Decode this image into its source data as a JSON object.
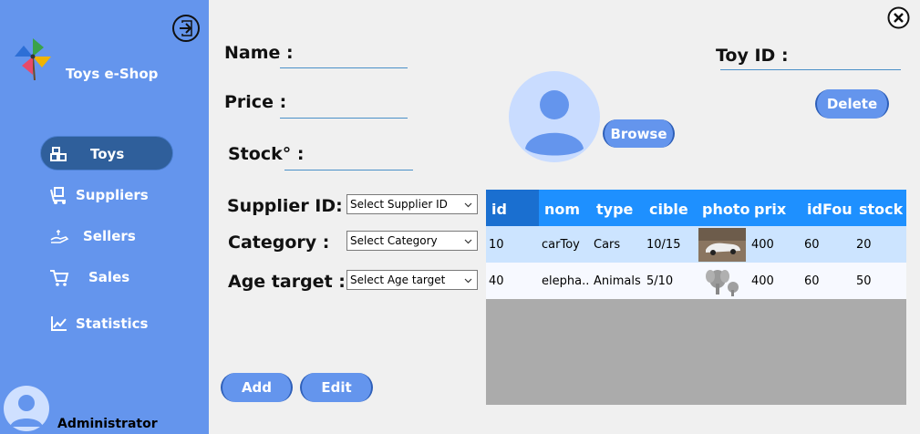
{
  "sidebar": {
    "brand": "Toys e-Shop",
    "nav": [
      {
        "label": "Toys",
        "icon": "toys-icon"
      },
      {
        "label": "Suppliers",
        "icon": "suppliers-icon"
      },
      {
        "label": "Sellers",
        "icon": "sellers-icon"
      },
      {
        "label": "Sales",
        "icon": "cart-icon"
      },
      {
        "label": "Statistics",
        "icon": "chart-icon"
      }
    ],
    "user": "Administrator"
  },
  "form": {
    "name_label": "Name :",
    "price_label": "Price :",
    "stock_label": "Stock° :",
    "toy_id_label": "Toy ID :",
    "supplier_label": "Supplier ID:",
    "category_label": "Category  :",
    "age_label": "Age target  :",
    "supplier_value": "Select Supplier ID",
    "category_value": "Select Category",
    "age_value": "Select Age target",
    "browse": "Browse",
    "delete": "Delete",
    "add": "Add",
    "edit": "Edit"
  },
  "grid": {
    "headers": [
      "id",
      "nom",
      "type",
      "cible",
      "photo",
      "prix",
      "idFourn",
      "stock"
    ],
    "rows": [
      {
        "id": "10",
        "nom": "carToy",
        "type": "Cars",
        "cible": "10/15",
        "photo": "car-photo",
        "prix": "400",
        "idFourn": "60",
        "stock": "20"
      },
      {
        "id": "40",
        "nom": "elepha...",
        "type": "Animals",
        "cible": "5/10",
        "photo": "elephant-photo",
        "prix": "400",
        "idFourn": "60",
        "stock": "50"
      }
    ]
  },
  "colors": {
    "sidebar": "#6495ed",
    "active_nav": "#2f5f9b",
    "grid_header": "#1e90ff",
    "selected_row": "#cce4ff"
  }
}
